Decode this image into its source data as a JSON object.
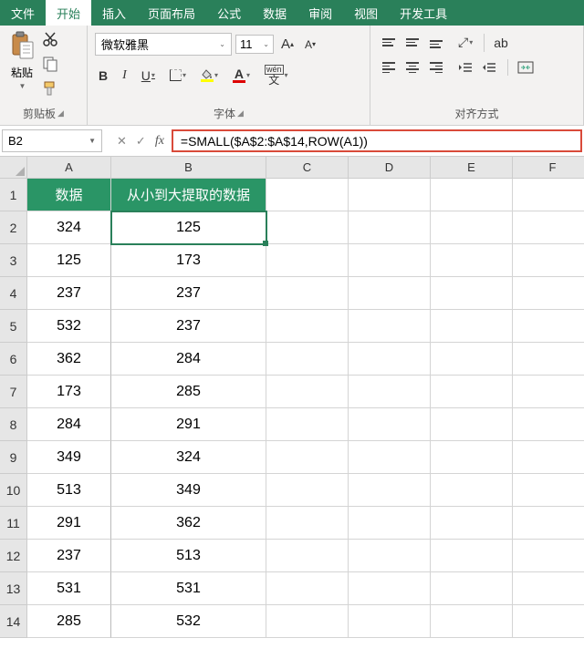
{
  "menu": {
    "file": "文件",
    "home": "开始",
    "insert": "插入",
    "layout": "页面布局",
    "formula": "公式",
    "data": "数据",
    "review": "审阅",
    "view": "视图",
    "dev": "开发工具"
  },
  "ribbon": {
    "clipboard": {
      "paste": "粘贴",
      "label": "剪贴板"
    },
    "font": {
      "name": "微软雅黑",
      "size": "11",
      "label": "字体",
      "bold": "B",
      "italic": "I",
      "underline": "U",
      "wen": "wén",
      "a": "A"
    },
    "align": {
      "label": "对齐方式",
      "ab": "ab"
    }
  },
  "fbar": {
    "namebox": "B2",
    "fx": "fx",
    "formula": "=SMALL($A$2:$A$14,ROW(A1))",
    "cancel": "✕",
    "enter": "✓"
  },
  "cols": [
    "A",
    "B",
    "C",
    "D",
    "E",
    "F"
  ],
  "rows": [
    "1",
    "2",
    "3",
    "4",
    "5",
    "6",
    "7",
    "8",
    "9",
    "10",
    "11",
    "12",
    "13",
    "14"
  ],
  "headers": {
    "a": "数据",
    "b": "从小到大提取的数据"
  },
  "table": {
    "a": [
      "324",
      "125",
      "237",
      "532",
      "362",
      "173",
      "284",
      "349",
      "513",
      "291",
      "237",
      "531",
      "285"
    ],
    "b": [
      "125",
      "173",
      "237",
      "237",
      "284",
      "285",
      "291",
      "324",
      "349",
      "362",
      "513",
      "531",
      "532"
    ]
  }
}
